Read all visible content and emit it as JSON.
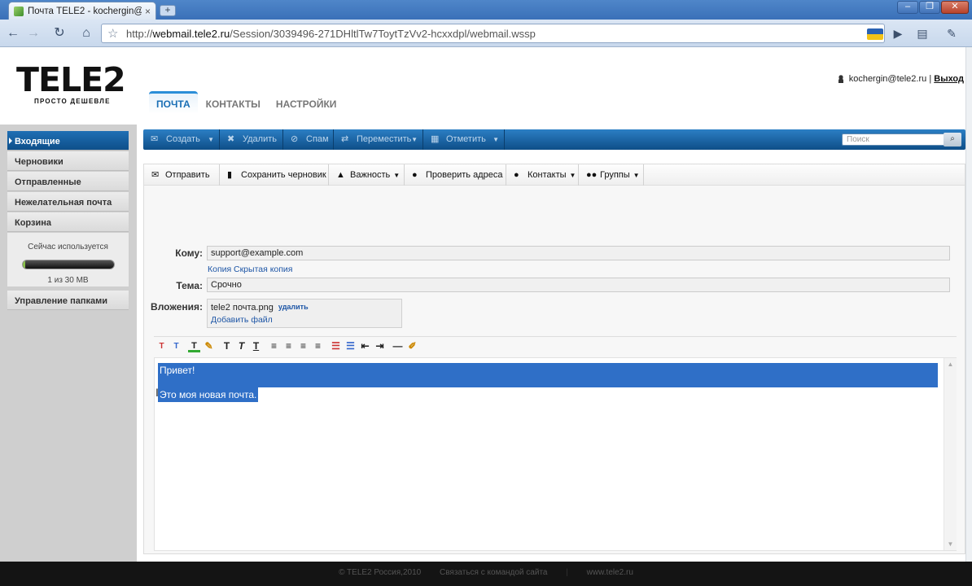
{
  "browser": {
    "tab_title": "Почта TELE2 - kochergin@...",
    "tab_close": "×",
    "new_tab": "+",
    "url_prefix": "http://",
    "url_domain": "webmail.tele2.ru",
    "url_path": "/Session/3039496-271DHltlTw7ToytTzVv2-hcxxdpl/webmail.wssp",
    "window_buttons": [
      "–",
      "❐",
      "✕"
    ]
  },
  "header": {
    "logo_text": "TELE2",
    "logo_slogan": "ПРОСТО ДЕШЕВЛЕ",
    "tabs": [
      {
        "label": "ПОЧТА",
        "active": true
      },
      {
        "label": "КОНТАКТЫ",
        "active": false
      },
      {
        "label": "НАСТРОЙКИ",
        "active": false
      }
    ],
    "user_email": "kochergin@tele2.ru",
    "separator": "|",
    "logout": "Выход"
  },
  "sidebar": {
    "folders": [
      {
        "label": "Входящие",
        "active": true
      },
      {
        "label": "Черновики",
        "active": false
      },
      {
        "label": "Отправленные",
        "active": false
      },
      {
        "label": "Нежелательная почта",
        "active": false
      },
      {
        "label": "Корзина",
        "active": false
      }
    ],
    "quota_label": "Сейчас используется",
    "quota_value": "1 из 30 MB",
    "quota_fraction": 0.033,
    "manage_folders": "Управление папками"
  },
  "actionbar": {
    "create": "Создать",
    "delete": "Удалить",
    "spam": "Спам",
    "move": "Переместить",
    "mark": "Отметить",
    "search_placeholder": "Поиск"
  },
  "compose": {
    "toolbar": {
      "send": "Отправить",
      "save_draft": "Сохранить черновик",
      "importance": "Важность",
      "check_addresses": "Проверить адреса",
      "contacts": "Контакты",
      "groups": "Группы"
    },
    "to_label": "Кому:",
    "to_value": "support@example.com",
    "cc_link": "Копия",
    "bcc_link": "Скрытая копия",
    "subject_label": "Тема:",
    "subject_value": "Срочно",
    "attachments_label": "Вложения:",
    "attachment_name": "tele2 почта.png",
    "attachment_delete": "удалить",
    "add_file": "Добавить файл",
    "body_line1": "Привет!",
    "body_line2": "Это моя новая почта."
  },
  "footer": {
    "copyright": "© TELE2 Россия,2010",
    "contact": "Связаться с командой сайта",
    "site": "www.tele2.ru"
  },
  "colors": {
    "accent_blue": "#1f6fb4",
    "selection": "#2f6fc7",
    "link": "#1e56a6",
    "footer_bg": "#141414"
  }
}
